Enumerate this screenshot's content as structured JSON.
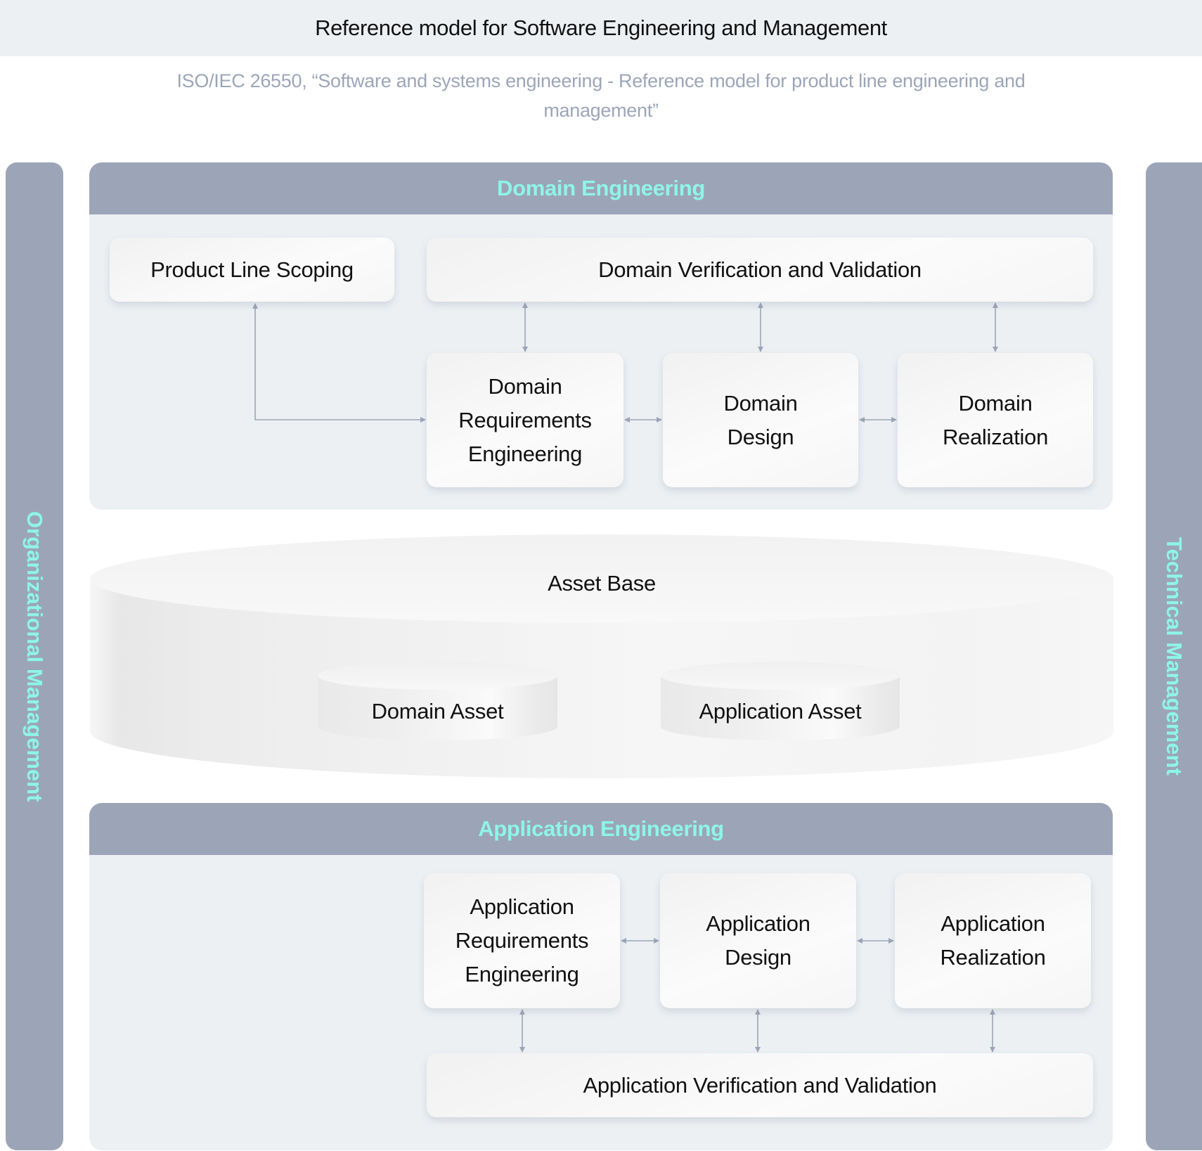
{
  "header": {
    "title": "Reference model for Software Engineering and Management",
    "subtitle": "ISO/IEC 26550, “Software and systems engineering - Reference model for product line engineering and management”"
  },
  "colors": {
    "accent_text": "#8ef5e8",
    "bar_fill": "#9ca5b8",
    "panel_fill": "#ecf0f3",
    "arrow": "#9ca5b8",
    "title_band": "#edf0f3"
  },
  "sidebars": {
    "left": "Organizational Management",
    "right": "Technical Management"
  },
  "domain_engineering": {
    "title": "Domain Engineering",
    "scoping": "Product Line Scoping",
    "verification": "Domain Verification and Validation",
    "processes": [
      "Domain Requirements Engineering",
      "Domain Design",
      "Domain Realization"
    ]
  },
  "asset_base": {
    "title": "Asset Base",
    "assets": [
      "Domain Asset",
      "Application Asset"
    ]
  },
  "application_engineering": {
    "title": "Application Engineering",
    "verification": "Application Verification and Validation",
    "processes": [
      "Application Requirements Engineering",
      "Application Design",
      "Application Realization"
    ]
  },
  "connections": [
    {
      "from": "Product Line Scoping",
      "to": "Domain Requirements Engineering",
      "type": "bidirectional"
    },
    {
      "from": "Domain Verification and Validation",
      "to": "Domain Requirements Engineering",
      "type": "bidirectional"
    },
    {
      "from": "Domain Verification and Validation",
      "to": "Domain Design",
      "type": "bidirectional"
    },
    {
      "from": "Domain Verification and Validation",
      "to": "Domain Realization",
      "type": "bidirectional"
    },
    {
      "from": "Domain Requirements Engineering",
      "to": "Domain Design",
      "type": "bidirectional"
    },
    {
      "from": "Domain Design",
      "to": "Domain Realization",
      "type": "bidirectional"
    },
    {
      "from": "Application Requirements Engineering",
      "to": "Application Design",
      "type": "bidirectional"
    },
    {
      "from": "Application Design",
      "to": "Application Realization",
      "type": "bidirectional"
    },
    {
      "from": "Application Requirements Engineering",
      "to": "Application Verification and Validation",
      "type": "bidirectional"
    },
    {
      "from": "Application Design",
      "to": "Application Verification and Validation",
      "type": "bidirectional"
    },
    {
      "from": "Application Realization",
      "to": "Application Verification and Validation",
      "type": "bidirectional"
    }
  ]
}
